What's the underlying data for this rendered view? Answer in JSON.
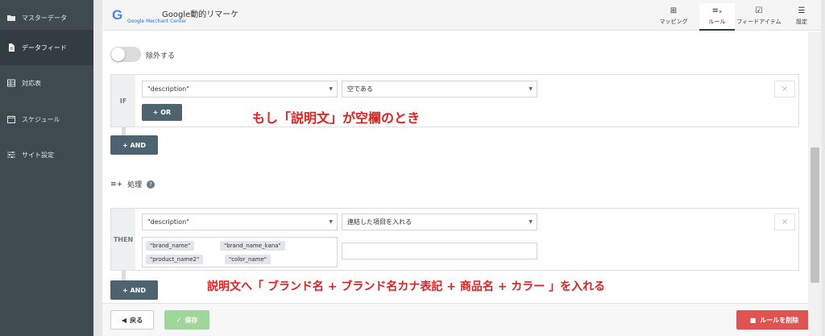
{
  "sidebar": {
    "items": [
      {
        "label": "マスターデータ",
        "icon": "folder-icon"
      },
      {
        "label": "データフィード",
        "icon": "file-icon"
      },
      {
        "label": "対応表",
        "icon": "table-icon"
      },
      {
        "label": "スケジュール",
        "icon": "calendar-icon"
      },
      {
        "label": "サイト設定",
        "icon": "sliders-icon"
      }
    ],
    "active_index": 1
  },
  "header": {
    "logo": "G",
    "title": "Google動的リマーケ",
    "subtitle": "Google Merchant Center",
    "tabs": [
      {
        "label": "マッピング",
        "icon": "mapping-icon"
      },
      {
        "label": "ルール",
        "icon": "rule-icon"
      },
      {
        "label": "フィードアイテム",
        "icon": "feed-item-icon"
      },
      {
        "label": "設定",
        "icon": "settings-icon"
      }
    ],
    "active_tab": 1
  },
  "exclude": {
    "label": "除外する",
    "enabled": false
  },
  "condition": {
    "side_label": "IF",
    "field": "\"description\"",
    "operator": "空である",
    "or_label": "+ OR",
    "and_label": "+ AND",
    "close_label": "×"
  },
  "process": {
    "title": "処理",
    "help": "?"
  },
  "action": {
    "side_label": "THEN",
    "field": "\"description\"",
    "operation": "連結した項目を入れる",
    "tags": [
      "\"brand_name\"",
      "\"brand_name_kana\"",
      "\"product_name2\"",
      "\"color_name\""
    ],
    "text_value": "",
    "and_label": "+ AND",
    "close_label": "×"
  },
  "annotations": {
    "if_note": "もし「説明文」が空欄のとき",
    "then_note": "説明文へ「 ブランド名 + ブランド名カナ表記 + 商品名 + カラー 」を入れる",
    "color": "#e61e1e"
  },
  "footer": {
    "back_label": "戻る",
    "save_label": "保存",
    "delete_label": "ルールを削除"
  },
  "colors": {
    "sidebar_bg": "#3f4a4f",
    "dark_button": "#4d6470",
    "save_button": "#9fd79b",
    "delete_button": "#e05353"
  }
}
